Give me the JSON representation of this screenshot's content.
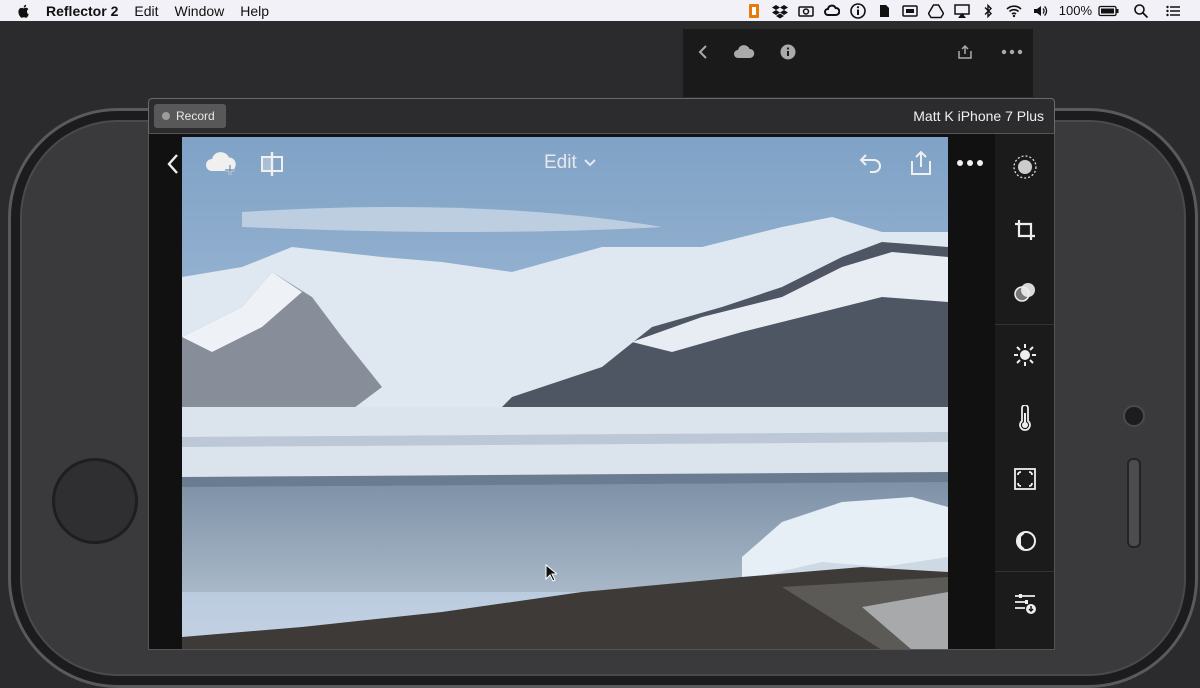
{
  "menubar": {
    "app_name": "Reflector 2",
    "menus": [
      "Edit",
      "Window",
      "Help"
    ],
    "battery_percent": "100%",
    "tray_icons": [
      "lightroom-icon",
      "dropbox-icon",
      "camera-icon",
      "creative-cloud-icon",
      "info-icon",
      "evernote-icon",
      "screen-icon",
      "drive-icon",
      "airplay-icon",
      "bluetooth-icon",
      "wifi-icon",
      "volume-icon",
      "battery-icon",
      "spotlight-icon",
      "notification-center-icon"
    ]
  },
  "reflector": {
    "record_label": "Record",
    "device_name": "Matt K iPhone 7 Plus"
  },
  "lightroom": {
    "edit_label": "Edit",
    "toolbar_icons": [
      "back-icon",
      "cloud-add-icon",
      "compare-icon",
      "undo-icon",
      "share-icon",
      "more-icon"
    ],
    "tools": [
      "selective-icon",
      "crop-icon",
      "presets-icon",
      "light-icon",
      "color-icon",
      "vignette-icon",
      "optics-icon",
      "adjust-icon"
    ]
  },
  "colors": {
    "menubar_bg": "#f2f1f7",
    "phone_body": "#3a3a3c",
    "sidebar_bg": "#1b1b1b"
  }
}
